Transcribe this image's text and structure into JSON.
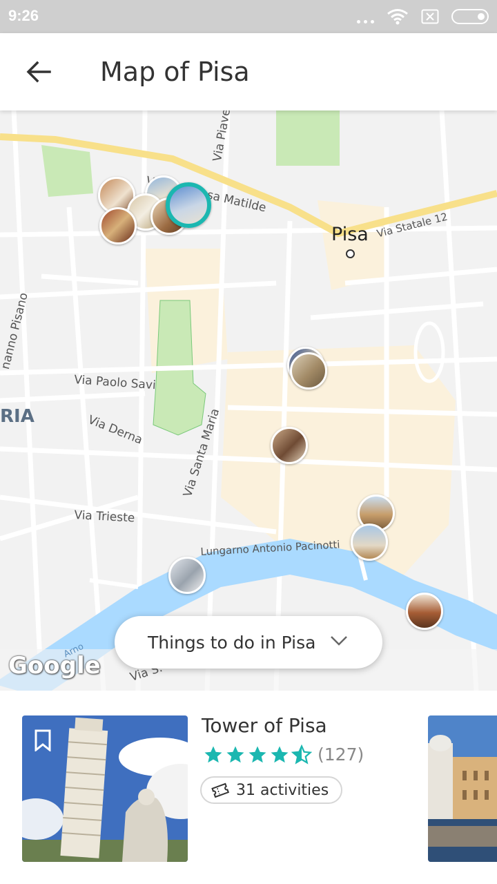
{
  "status_bar": {
    "time": "9:26"
  },
  "header": {
    "title": "Map of Pisa",
    "back_icon": "arrow-left-icon"
  },
  "map": {
    "city_label": "Pisa",
    "district_label": "RIA",
    "streets": [
      "Via Contessa Matilde",
      "Via Statale 12",
      "Via Piave",
      "Via Paolo Savi",
      "Via Derna",
      "Via Santa Maria",
      "Via Trieste",
      "Lungarno Antonio Pacinotti",
      "nanno Pisano",
      "Arno",
      "Via S."
    ],
    "attribution": "Google",
    "colors": {
      "water": "#aadaff",
      "park": "#c9e9b6",
      "road_main": "#f8e08a",
      "old_town": "#fbf1dc"
    }
  },
  "filter": {
    "label": "Things to do in Pisa",
    "icon": "chevron-down-icon"
  },
  "card": {
    "title": "Tower of Pisa",
    "rating": 4.5,
    "rating_max": 5,
    "reviews": "(127)",
    "activities": "31 activities",
    "accent": "#1bb7b0"
  }
}
